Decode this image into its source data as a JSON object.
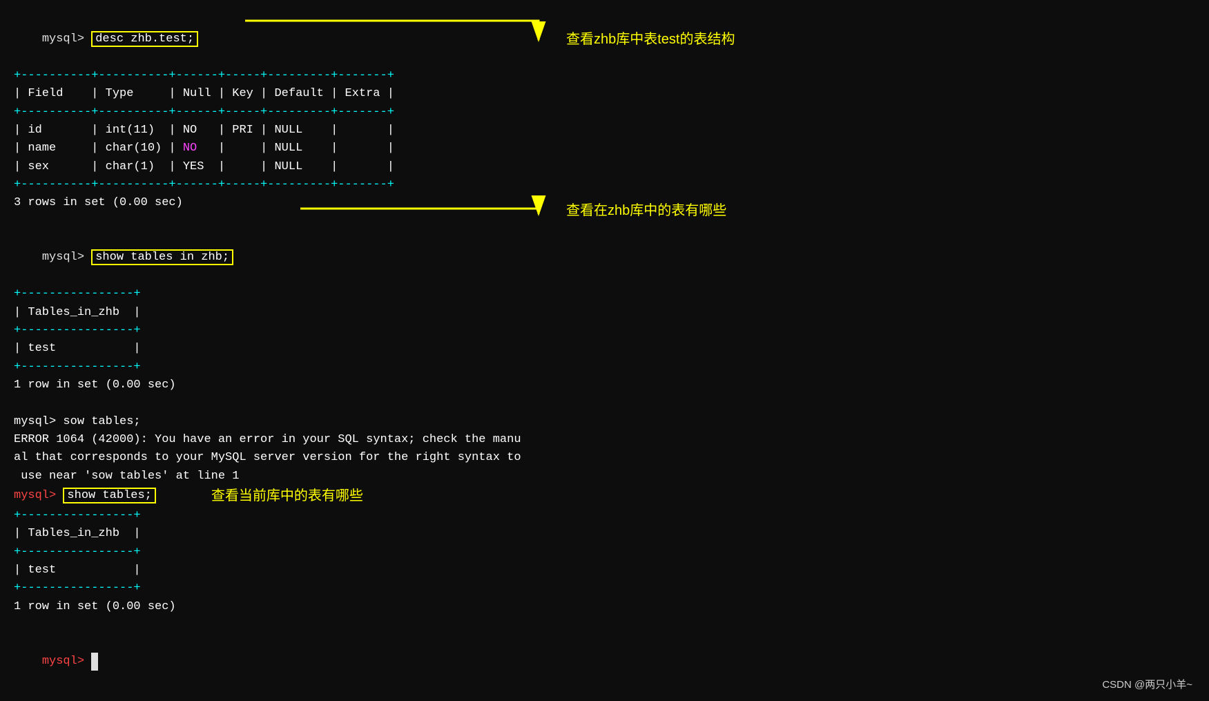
{
  "terminal": {
    "bg": "#0d0d0d",
    "lines": {
      "desc_cmd": "desc zhb.test;",
      "table_header_separator": "+----------+----------+------+-----+---------+-------+",
      "table_header": "| Field    | Type     | Null | Key | Default | Extra |",
      "row_id": "|  id      | int(11)  | NO   | PRI | NULL    |       |",
      "row_name": "|  name    | char(10) | NO   |     | NULL    |       |",
      "row_sex": "|  sex     | char(1)  | YES  |     | NULL    |       |",
      "rows_in_set_1": "3 rows in set (0.00 sec)",
      "show_tables_cmd": "show tables in zhb;",
      "table2_header_sep": "+----------------+",
      "table2_header": "| Tables_in_zhb  |",
      "table2_row": "| test           |",
      "rows_in_set_2": "1 row in set (0.00 sec)",
      "sow_cmd": "mysql> sow tables;",
      "error_line1": "ERROR 1064 (42000): You have an error in your SQL syntax; check the manu",
      "error_line2": "al that corresponds to your MySQL server version for the right syntax to",
      "error_line3": " use near 'sow tables' at line 1",
      "show_tables2_cmd": "show tables;",
      "annotation_show_tables2": "查看当前库中的表有哪些",
      "table3_header_sep": "+----------------+",
      "table3_header": "| Tables_in_zhb  |",
      "table3_row": "| test           |",
      "rows_in_set_3": "1 row in set (0.00 sec)",
      "final_prompt": "mysql> "
    },
    "annotations": {
      "arrow1_text": "查看zhb库中表test的表结构",
      "arrow2_text": "查看在zhb库中的表有哪些"
    },
    "watermark": "CSDN @两只小羊~"
  }
}
